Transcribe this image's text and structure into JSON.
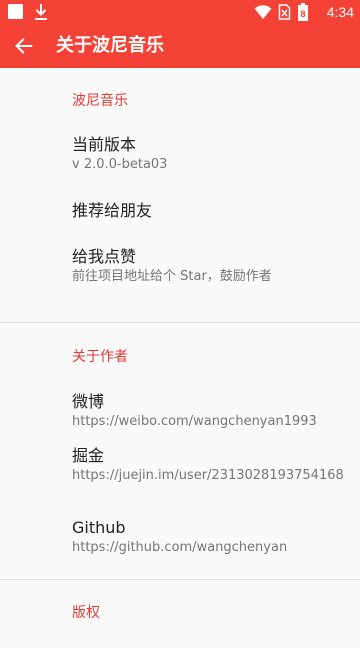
{
  "status_bar": {
    "time": "4:34",
    "battery_level": "8",
    "icons": [
      "notification-square-icon",
      "download-icon",
      "wifi-icon",
      "no-sim-icon",
      "battery-icon"
    ]
  },
  "toolbar": {
    "back_icon": "arrow-left-icon",
    "title": "关于波尼音乐"
  },
  "sections": [
    {
      "category": "波尼音乐",
      "items": [
        {
          "title": "当前版本",
          "summary": "v 2.0.0-beta03"
        },
        {
          "title": "推荐给朋友",
          "summary": ""
        },
        {
          "title": "给我点赞",
          "summary": "前往项目地址给个 Star，鼓励作者"
        }
      ]
    },
    {
      "category": "关于作者",
      "items": [
        {
          "title": "微博",
          "summary": "https://weibo.com/wangchenyan1993"
        },
        {
          "title": "掘金",
          "summary": "https://juejin.im/user/2313028193754168"
        },
        {
          "title": "Github",
          "summary": "https://github.com/wangchenyan"
        }
      ]
    },
    {
      "category": "版权",
      "items": []
    }
  ],
  "colors": {
    "primary": "#f44336",
    "accent": "#e53935",
    "background": "#fafafa",
    "title_text": "#212121",
    "summary_text": "#757575",
    "divider": "#dcdcdc"
  }
}
